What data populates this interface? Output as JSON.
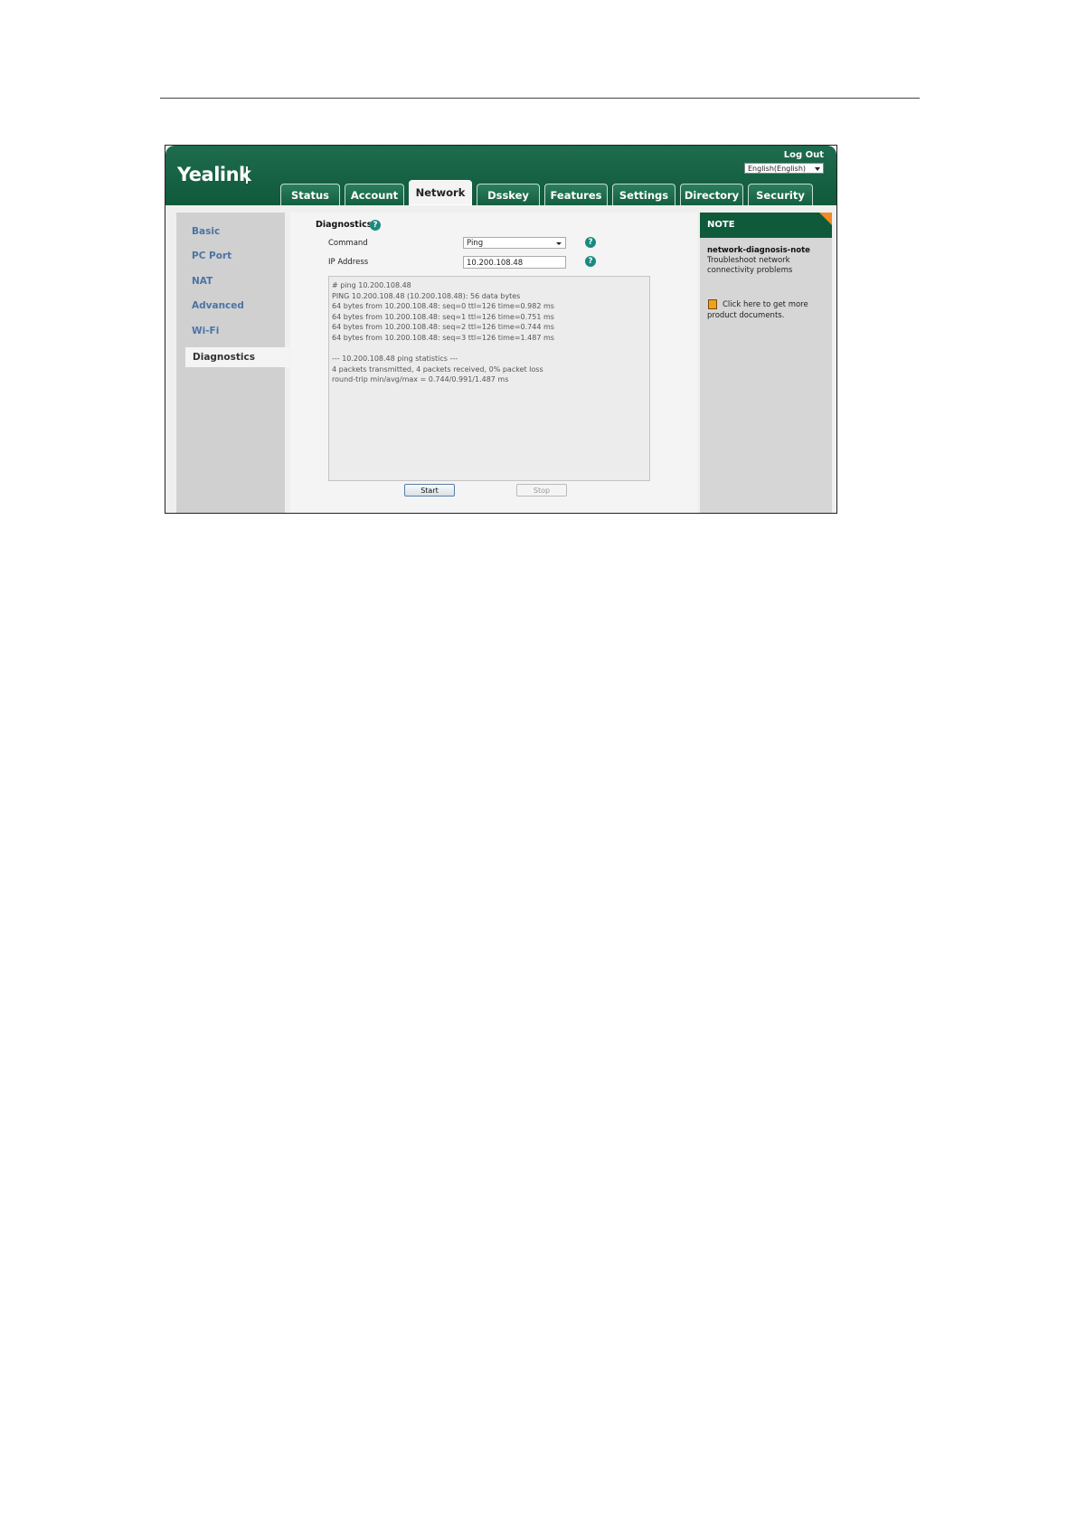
{
  "header": {
    "logo": "Yealink",
    "logout": "Log Out",
    "language": "English(English)"
  },
  "tabs": [
    {
      "label": "Status"
    },
    {
      "label": "Account"
    },
    {
      "label": "Network"
    },
    {
      "label": "Dsskey"
    },
    {
      "label": "Features"
    },
    {
      "label": "Settings"
    },
    {
      "label": "Directory"
    },
    {
      "label": "Security"
    }
  ],
  "sidebar": {
    "items": [
      {
        "label": "Basic"
      },
      {
        "label": "PC Port"
      },
      {
        "label": "NAT"
      },
      {
        "label": "Advanced"
      },
      {
        "label": "Wi-Fi"
      },
      {
        "label": "Diagnostics"
      }
    ]
  },
  "main": {
    "section_title": "Diagnostics",
    "command_label": "Command",
    "command_value": "Ping",
    "ip_label": "IP Address",
    "ip_value": "10.200.108.48",
    "output_lines": [
      "# ping 10.200.108.48",
      "PING 10.200.108.48 (10.200.108.48): 56 data bytes",
      "64 bytes from 10.200.108.48: seq=0 ttl=126 time=0.982 ms",
      "64 bytes from 10.200.108.48: seq=1 ttl=126 time=0.751 ms",
      "64 bytes from 10.200.108.48: seq=2 ttl=126 time=0.744 ms",
      "64 bytes from 10.200.108.48: seq=3 ttl=126 time=1.487 ms",
      "",
      "--- 10.200.108.48 ping statistics ---",
      "4 packets transmitted, 4 packets received, 0% packet loss",
      "round-trip min/avg/max = 0.744/0.991/1.487 ms"
    ],
    "start_label": "Start",
    "stop_label": "Stop"
  },
  "note": {
    "heading": "NOTE",
    "title": "network-diagnosis-note",
    "text": "Troubleshoot network connectivity problems",
    "doc_link": "Click here to get more product documents."
  },
  "colors": {
    "brand_green": "#0f5a3b",
    "accent_orange": "#f08a24",
    "help_teal": "#1a8a80",
    "nav_blue": "#4b74a6"
  }
}
